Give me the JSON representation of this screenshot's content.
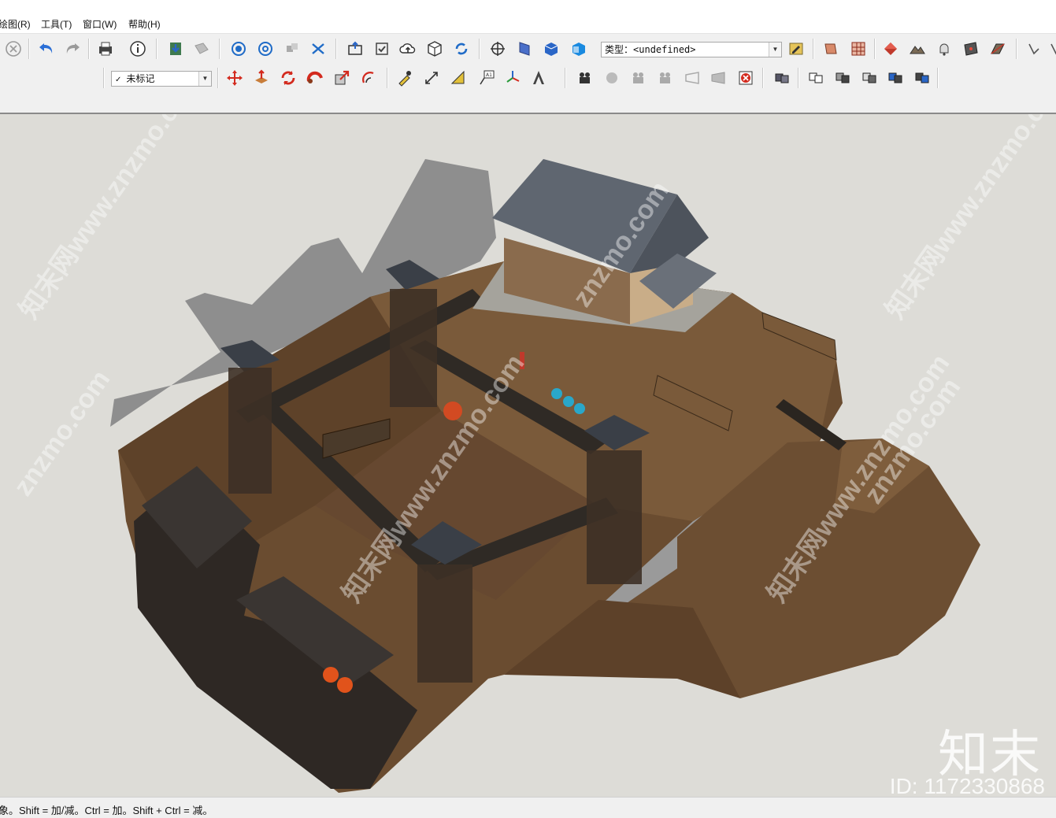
{
  "menu": {
    "items": [
      {
        "label": "绘图(R)"
      },
      {
        "label": "工具(T)"
      },
      {
        "label": "窗口(W)"
      },
      {
        "label": "帮助(H)"
      }
    ]
  },
  "toolbar": {
    "type_label": "类型：",
    "type_value": "<undefined>",
    "tag_value": "未标记"
  },
  "status": {
    "text": "象。Shift = 加/减。Ctrl = 加。Shift + Ctrl = 减。"
  },
  "watermark": {
    "site": "知末网www.znzmo.com",
    "site2": "znzmo.com",
    "brand": "知末",
    "id": "ID: 1172330868"
  },
  "colors": {
    "viewport_bg": "#dddcd7",
    "terrain": "#6e5136",
    "roof": "#5d6470",
    "shadow": "#8d8d8d"
  }
}
